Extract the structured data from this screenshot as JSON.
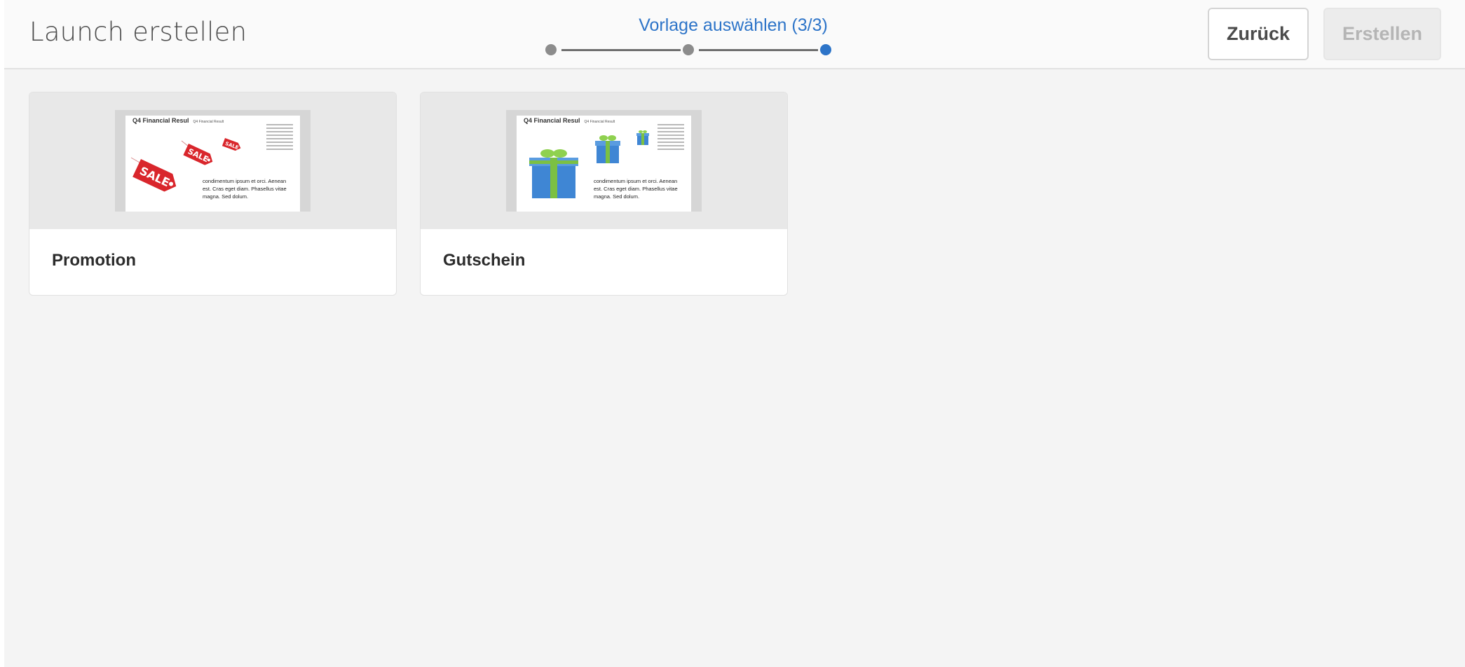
{
  "header": {
    "title": "Launch erstellen",
    "step_label": "Vorlage auswählen (3/3)",
    "steps": [
      {
        "state": "completed"
      },
      {
        "state": "completed"
      },
      {
        "state": "current"
      }
    ],
    "back_label": "Zurück",
    "create_label": "Erstellen"
  },
  "colors": {
    "accent": "#2d74c8",
    "step_done": "#8c8c8c",
    "background": "#f4f4f4"
  },
  "templates": [
    {
      "label": "Promotion",
      "preview": {
        "heading": "Q4 Financial Resul",
        "sub_heading": "Q4 Financial Result",
        "body_text": "condimentum ipsum et orci. Aenean est. Cras eget diam. Phasellus vitae magna. Sed dolum.",
        "tag_text": "SALE"
      }
    },
    {
      "label": "Gutschein",
      "preview": {
        "heading": "Q4 Financial Resul",
        "sub_heading": "Q4 Financial Result",
        "body_text": "condimentum ipsum et orci. Aenean est. Cras eget diam. Phasellus vitae magna. Sed dolum."
      }
    }
  ]
}
